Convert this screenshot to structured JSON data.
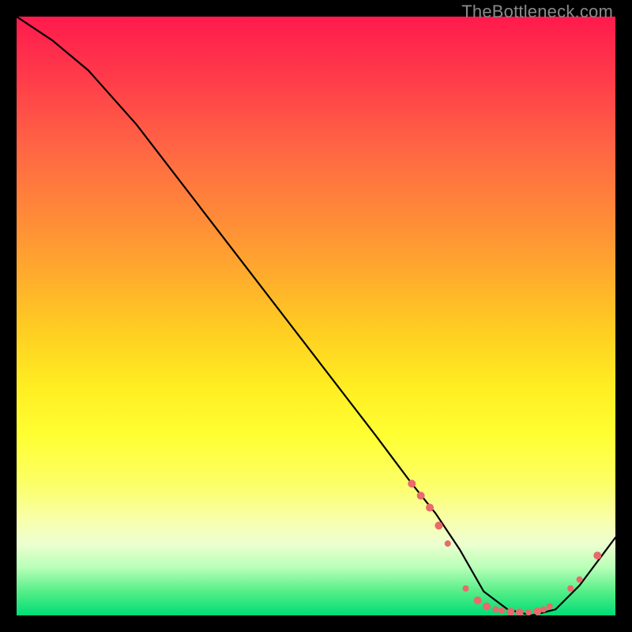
{
  "watermark": "TheBottleneck.com",
  "chart_data": {
    "type": "line",
    "title": "",
    "xlabel": "",
    "ylabel": "",
    "xlim": [
      0,
      100
    ],
    "ylim": [
      0,
      100
    ],
    "grid": false,
    "series": [
      {
        "name": "curve",
        "x": [
          0,
          6,
          12,
          20,
          30,
          40,
          50,
          60,
          66,
          70,
          74,
          78,
          82,
          86,
          90,
          94,
          100
        ],
        "y": [
          100,
          96,
          91,
          82,
          69,
          56,
          43,
          30,
          22,
          17,
          11,
          4,
          1,
          0,
          1,
          5,
          13
        ],
        "color": "#000000"
      }
    ],
    "markers": [
      {
        "x": 66,
        "y": 22,
        "r": 5,
        "color": "#e86a6a"
      },
      {
        "x": 67.5,
        "y": 20,
        "r": 5,
        "color": "#e86a6a"
      },
      {
        "x": 69,
        "y": 18,
        "r": 5,
        "color": "#e86a6a"
      },
      {
        "x": 70.5,
        "y": 15,
        "r": 5,
        "color": "#e86a6a"
      },
      {
        "x": 72,
        "y": 12,
        "r": 4,
        "color": "#e86a6a"
      },
      {
        "x": 75,
        "y": 4.5,
        "r": 4,
        "color": "#e86a6a"
      },
      {
        "x": 77,
        "y": 2.5,
        "r": 5,
        "color": "#e86a6a"
      },
      {
        "x": 78.5,
        "y": 1.5,
        "r": 5,
        "color": "#e86a6a"
      },
      {
        "x": 80,
        "y": 1.0,
        "r": 4,
        "color": "#e86a6a"
      },
      {
        "x": 81,
        "y": 0.8,
        "r": 4,
        "color": "#e86a6a"
      },
      {
        "x": 82.5,
        "y": 0.6,
        "r": 5,
        "color": "#e86a6a"
      },
      {
        "x": 84,
        "y": 0.5,
        "r": 5,
        "color": "#e86a6a"
      },
      {
        "x": 85.5,
        "y": 0.5,
        "r": 4,
        "color": "#e86a6a"
      },
      {
        "x": 87,
        "y": 0.7,
        "r": 5,
        "color": "#e86a6a"
      },
      {
        "x": 88,
        "y": 1.0,
        "r": 4,
        "color": "#e86a6a"
      },
      {
        "x": 89,
        "y": 1.5,
        "r": 4,
        "color": "#e86a6a"
      },
      {
        "x": 92.5,
        "y": 4.5,
        "r": 4,
        "color": "#e86a6a"
      },
      {
        "x": 94,
        "y": 6,
        "r": 4,
        "color": "#e86a6a"
      },
      {
        "x": 97,
        "y": 10,
        "r": 5,
        "color": "#e86a6a"
      }
    ]
  }
}
